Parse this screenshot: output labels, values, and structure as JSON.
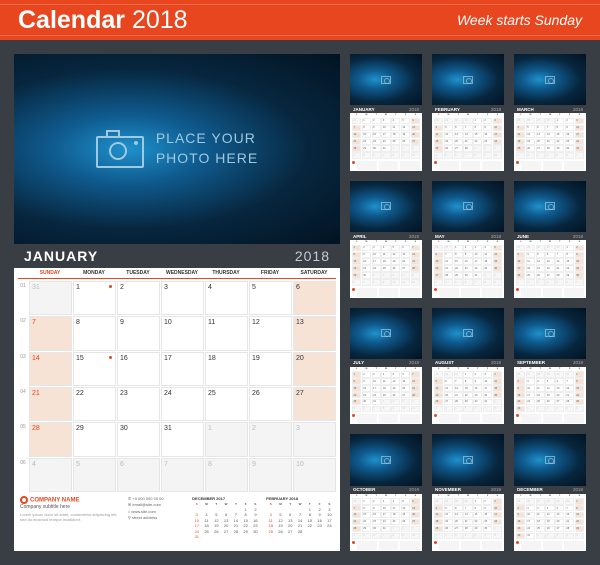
{
  "header": {
    "title_text": "Calendar",
    "title_year": "2018",
    "subtitle": "Week starts Sunday"
  },
  "photo": {
    "placeholder_line1": "PLACE YOUR",
    "placeholder_line2": "PHOTO HERE"
  },
  "main_month": {
    "name": "JANUARY",
    "year": "2018",
    "days": [
      "SUNDAY",
      "MONDAY",
      "TUESDAY",
      "WEDNESDAY",
      "THURSDAY",
      "FRIDAY",
      "SATURDAY"
    ],
    "week_numbers": [
      "01",
      "02",
      "03",
      "04",
      "05",
      "06"
    ],
    "grid": [
      [
        {
          "d": "31",
          "other": true
        },
        {
          "d": "1",
          "dot": true
        },
        {
          "d": "2"
        },
        {
          "d": "3"
        },
        {
          "d": "4"
        },
        {
          "d": "5"
        },
        {
          "d": "6"
        }
      ],
      [
        {
          "d": "7"
        },
        {
          "d": "8"
        },
        {
          "d": "9"
        },
        {
          "d": "10"
        },
        {
          "d": "11"
        },
        {
          "d": "12"
        },
        {
          "d": "13"
        }
      ],
      [
        {
          "d": "14"
        },
        {
          "d": "15",
          "dot": true
        },
        {
          "d": "16"
        },
        {
          "d": "17"
        },
        {
          "d": "18"
        },
        {
          "d": "19"
        },
        {
          "d": "20"
        }
      ],
      [
        {
          "d": "21"
        },
        {
          "d": "22"
        },
        {
          "d": "23"
        },
        {
          "d": "24"
        },
        {
          "d": "25"
        },
        {
          "d": "26"
        },
        {
          "d": "27"
        }
      ],
      [
        {
          "d": "28"
        },
        {
          "d": "29"
        },
        {
          "d": "30"
        },
        {
          "d": "31"
        },
        {
          "d": "1",
          "other": true
        },
        {
          "d": "2",
          "other": true
        },
        {
          "d": "3",
          "other": true
        }
      ],
      [
        {
          "d": "4",
          "other": true
        },
        {
          "d": "5",
          "other": true
        },
        {
          "d": "6",
          "other": true
        },
        {
          "d": "7",
          "other": true
        },
        {
          "d": "8",
          "other": true
        },
        {
          "d": "9",
          "other": true
        },
        {
          "d": "10",
          "other": true
        }
      ]
    ]
  },
  "company": {
    "name": "COMPANY NAME",
    "subtitle": "Company subtitle here",
    "lorem": "Lorem ipsum dolor sit amet, consectetur adipiscing elit, sed do eiusmod tempor incididunt.",
    "contacts": [
      "✆ +0 000 000 00 00",
      "✉ email@site.com",
      "⌂ www.site.com",
      "⚲ street address"
    ]
  },
  "mini_prev": {
    "name": "DECEMBER 2017",
    "days": [
      "S",
      "M",
      "T",
      "W",
      "T",
      "F",
      "S"
    ],
    "rows": [
      [
        "",
        "",
        "",
        "",
        "",
        "1",
        "2"
      ],
      [
        "3",
        "4",
        "5",
        "6",
        "7",
        "8",
        "9"
      ],
      [
        "10",
        "11",
        "12",
        "13",
        "14",
        "15",
        "16"
      ],
      [
        "17",
        "18",
        "19",
        "20",
        "21",
        "22",
        "23"
      ],
      [
        "24",
        "25",
        "26",
        "27",
        "28",
        "29",
        "30"
      ],
      [
        "31",
        "",
        "",
        "",
        "",
        "",
        ""
      ]
    ]
  },
  "mini_next": {
    "name": "FEBRUARY 2018",
    "days": [
      "S",
      "M",
      "T",
      "W",
      "T",
      "F",
      "S"
    ],
    "rows": [
      [
        "",
        "",
        "",
        "",
        "1",
        "2",
        "3"
      ],
      [
        "4",
        "5",
        "6",
        "7",
        "8",
        "9",
        "10"
      ],
      [
        "11",
        "12",
        "13",
        "14",
        "15",
        "16",
        "17"
      ],
      [
        "18",
        "19",
        "20",
        "21",
        "22",
        "23",
        "24"
      ],
      [
        "25",
        "26",
        "27",
        "28",
        "",
        "",
        ""
      ]
    ]
  },
  "thumbs": {
    "year": "2018",
    "days": [
      "S",
      "M",
      "T",
      "W",
      "T",
      "F",
      "S"
    ],
    "months": [
      {
        "name": "JANUARY",
        "start": 1,
        "len": 31,
        "prev": 31
      },
      {
        "name": "FEBRUARY",
        "start": 4,
        "len": 28,
        "prev": 31
      },
      {
        "name": "MARCH",
        "start": 4,
        "len": 31,
        "prev": 28
      },
      {
        "name": "APRIL",
        "start": 0,
        "len": 30,
        "prev": 31
      },
      {
        "name": "MAY",
        "start": 2,
        "len": 31,
        "prev": 30
      },
      {
        "name": "JUNE",
        "start": 5,
        "len": 30,
        "prev": 31
      },
      {
        "name": "JULY",
        "start": 0,
        "len": 31,
        "prev": 30
      },
      {
        "name": "AUGUST",
        "start": 3,
        "len": 31,
        "prev": 31
      },
      {
        "name": "SEPTEMBER",
        "start": 6,
        "len": 30,
        "prev": 31
      },
      {
        "name": "OCTOBER",
        "start": 1,
        "len": 31,
        "prev": 30
      },
      {
        "name": "NOVEMBER",
        "start": 4,
        "len": 30,
        "prev": 31
      },
      {
        "name": "DECEMBER",
        "start": 6,
        "len": 31,
        "prev": 30
      }
    ]
  }
}
